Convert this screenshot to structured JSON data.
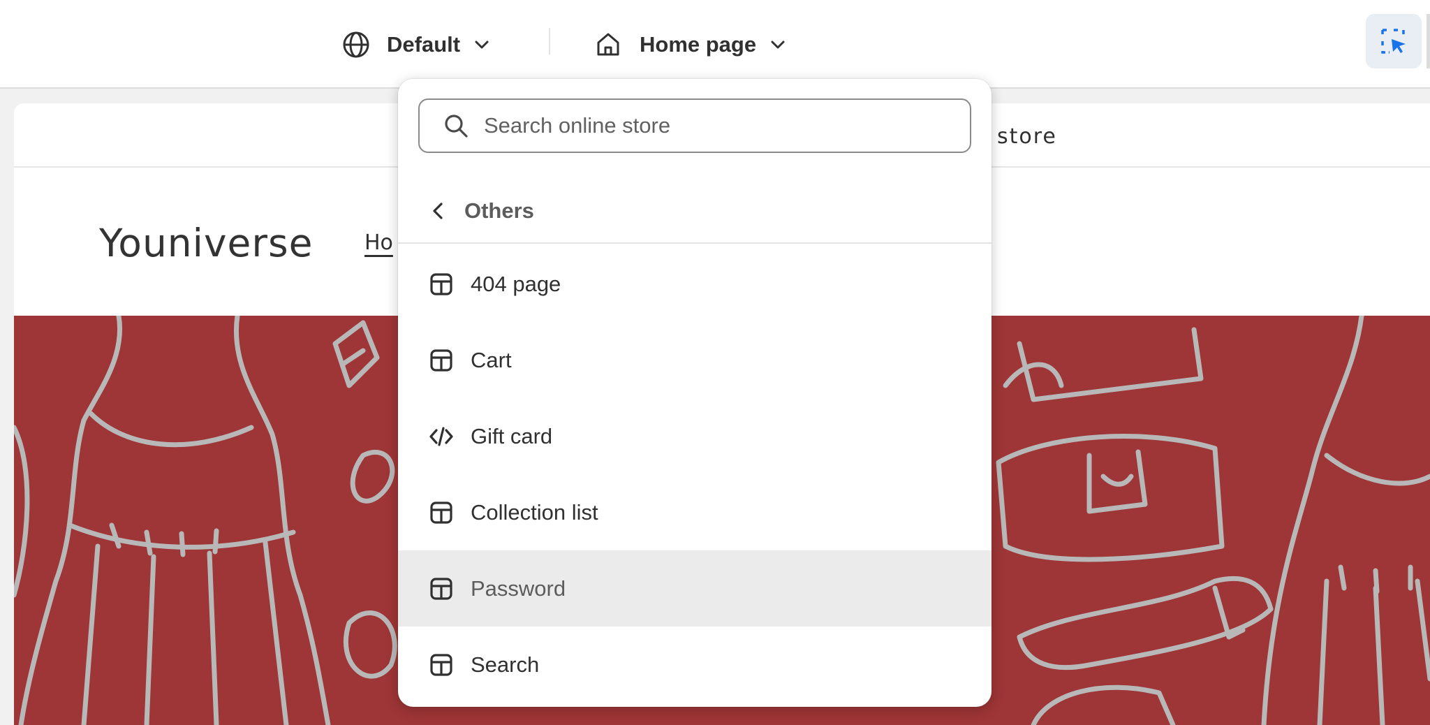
{
  "toolbar": {
    "locale_label": "Default",
    "template_label": "Home page"
  },
  "preview": {
    "announcement_text": "store",
    "store_name": "Youniverse",
    "nav_first_item": "Ho"
  },
  "dropdown": {
    "search_placeholder": "Search online store",
    "back_label": "Others",
    "items": [
      {
        "label": "404 page",
        "icon": "template-icon"
      },
      {
        "label": "Cart",
        "icon": "template-icon"
      },
      {
        "label": "Gift card",
        "icon": "code-icon"
      },
      {
        "label": "Collection list",
        "icon": "template-icon"
      },
      {
        "label": "Password",
        "icon": "template-icon",
        "active": true
      },
      {
        "label": "Search",
        "icon": "template-icon"
      }
    ]
  },
  "colors": {
    "hero_background": "#9e3536",
    "accent": "#1a73e8",
    "active_row": "#ebebeb"
  }
}
